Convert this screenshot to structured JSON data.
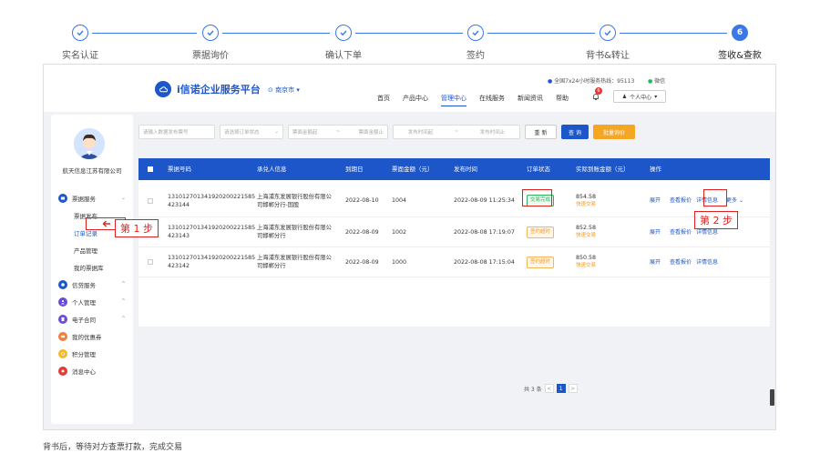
{
  "stepper": {
    "steps": [
      {
        "label": "实名认证",
        "state": "done"
      },
      {
        "label": "票据询价",
        "state": "done"
      },
      {
        "label": "确认下单",
        "state": "done"
      },
      {
        "label": "签约",
        "state": "done"
      },
      {
        "label": "背书&转让",
        "state": "done"
      },
      {
        "label": "签收&查款",
        "state": "active",
        "number": "6"
      }
    ]
  },
  "header": {
    "brand": "i信诺企业服务平台",
    "city": "南京市",
    "hotline": "全国7x24小时服务热线：95113",
    "wechat": "微信",
    "nav": [
      "首页",
      "产品中心",
      "管理中心",
      "在线服务",
      "新闻资讯",
      "帮助"
    ],
    "active_nav": "管理中心",
    "bell_count": "6",
    "user_menu": "个人中心"
  },
  "sidebar": {
    "company": "航天信息江苏有限公司",
    "menu": [
      {
        "label": "票据服务",
        "icon": "ticket-icon",
        "color": "#1d56c9",
        "chevron": "⌄",
        "children": [
          "票据发布",
          "订单记录",
          "产品管理",
          "我的票据库"
        ]
      },
      {
        "label": "信贷服务",
        "icon": "credit-icon",
        "color": "#1d56c9",
        "chevron": "^"
      },
      {
        "label": "个人管理",
        "icon": "person-icon",
        "color": "#6a4cd8",
        "chevron": "^"
      },
      {
        "label": "电子合同",
        "icon": "contract-icon",
        "color": "#6a4cd8",
        "chevron": "^"
      },
      {
        "label": "我的优惠券",
        "icon": "coupon-icon",
        "color": "#f57c3a"
      },
      {
        "label": "积分管理",
        "icon": "points-icon",
        "color": "#f5b82a"
      },
      {
        "label": "消息中心",
        "icon": "message-icon",
        "color": "#e53935"
      }
    ],
    "active_child": "订单记录"
  },
  "filters": {
    "ticket_no": "请输入数据发布票号",
    "status": "请选择订单状态",
    "min_amount": "票面金额起",
    "max_amount": "票面金额止",
    "date_from": "发布时间起",
    "date_to": "发布时间止",
    "reset": "重 新",
    "search": "查 询",
    "batch": "批量询价"
  },
  "table": {
    "columns": [
      "票据号码",
      "承兑人信息",
      "到期日",
      "票面金额（元）",
      "发布时间",
      "订单状态",
      "实际到账金额（元）",
      "操作"
    ],
    "rows": [
      {
        "no1": "131012701341920200221585",
        "no2": "423144",
        "acceptor": "上海浦东发展银行股份有限公司邯郸分行-国股",
        "due": "2022-08-10",
        "amount": "1004",
        "published": "2022-08-09 11:25:34",
        "status": "交易完成",
        "status_type": "green",
        "received": "854.58",
        "received_sub": "快速交易",
        "ops": [
          "展开",
          "查看报价",
          "详情信息",
          "更多"
        ]
      },
      {
        "no1": "131012701341920200221585",
        "no2": "423143",
        "acceptor": "上海浦东发展银行股份有限公司邯郸分行",
        "due": "2022-08-09",
        "amount": "1002",
        "published": "2022-08-08 17:19:07",
        "status": "签约超时",
        "status_type": "orange",
        "received": "852.58",
        "received_sub": "快速交易",
        "ops": [
          "展开",
          "查看报价",
          "详情信息"
        ]
      },
      {
        "no1": "131012701341920200221585",
        "no2": "423142",
        "acceptor": "上海浦东发展银行股份有限公司邯郸分行",
        "due": "2022-08-09",
        "amount": "1000",
        "published": "2022-08-08 17:15:04",
        "status": "签约超时",
        "status_type": "orange",
        "received": "850.58",
        "received_sub": "快速交易",
        "ops": [
          "展开",
          "查看报价",
          "详情信息"
        ]
      }
    ],
    "pager": {
      "total": "共 3 条",
      "prev": "<",
      "current": "1",
      "next": ">"
    }
  },
  "callouts": {
    "step1": "第 1 步",
    "step2": "第 2 步"
  },
  "caption": "背书后，等待对方查票打款，完成交易",
  "colors": {
    "primary": "#1d56c9",
    "accent": "#3a78e8",
    "annotation": "#e0201f",
    "success": "#2bb35a",
    "warning": "#f59a23"
  }
}
